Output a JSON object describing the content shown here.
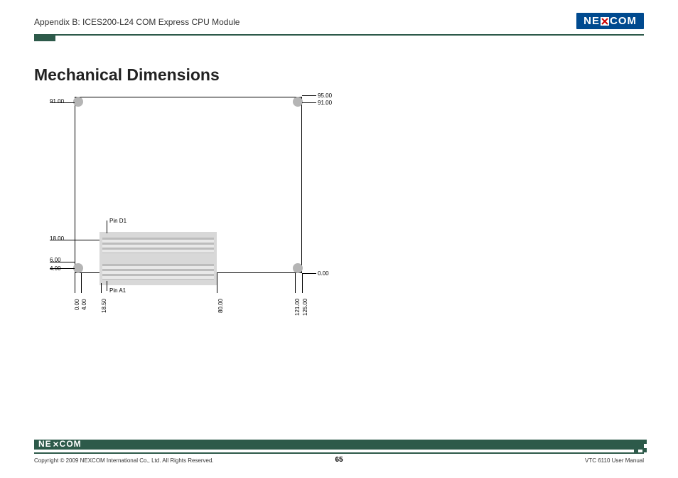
{
  "header": {
    "appendix": "Appendix B: ICES200-L24 COM Express CPU Module",
    "brand_prefix": "NE",
    "brand_suffix": "COM"
  },
  "heading": "Mechanical Dimensions",
  "diagram": {
    "pins": {
      "d1": "Pin D1",
      "a1": "Pin A1"
    },
    "y_dims": {
      "y91": "91.00",
      "y18": "18.00",
      "y6": "6.00",
      "y4": "4.00",
      "y95": "95.00",
      "y91r": "91.00",
      "y0": "0.00"
    },
    "x_dims": {
      "x0": "0.00",
      "x4": "4.00",
      "x18_5": "18.50",
      "x80": "80.00",
      "x121": "121.00",
      "x125": "125.00"
    }
  },
  "footer": {
    "copyright": "Copyright © 2009 NEXCOM International Co., Ltd. All Rights Reserved.",
    "page": "65",
    "manual": "VTC 6110 User Manual",
    "brand_prefix": "NE",
    "brand_suffix": "COM"
  }
}
